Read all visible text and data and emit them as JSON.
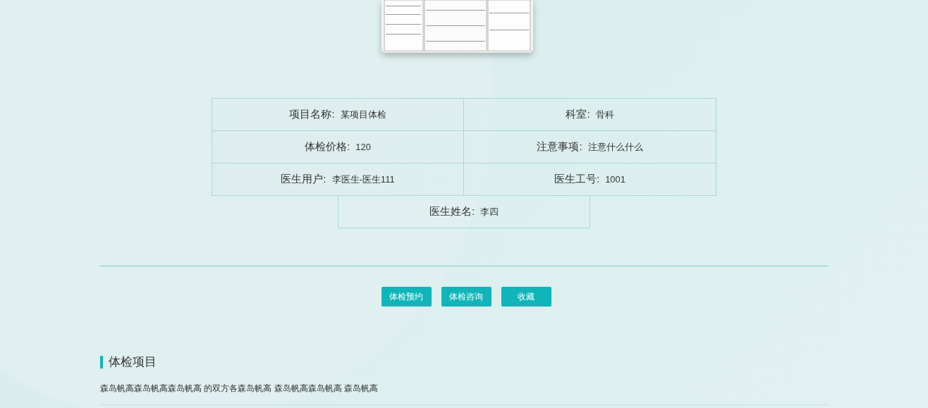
{
  "info_table": {
    "rows": [
      [
        {
          "label": "项目名称:",
          "value": "某项目体检"
        },
        {
          "label": "科室:",
          "value": "骨科"
        }
      ],
      [
        {
          "label": "体检价格:",
          "value": "120"
        },
        {
          "label": "注意事项:",
          "value": "注意什么什么"
        }
      ],
      [
        {
          "label": "医生用户:",
          "value": "李医生-医生111"
        },
        {
          "label": "医生工号:",
          "value": "1001"
        }
      ]
    ],
    "last_row": {
      "label": "医生姓名:",
      "value": "李四"
    }
  },
  "buttons": [
    "体检预约",
    "体检咨询",
    "收藏"
  ],
  "section": {
    "title": "体检项目",
    "description": "森岛帆高森岛帆高森岛帆高 的双方各森岛帆高 森岛帆高森岛帆高 森岛帆高"
  }
}
